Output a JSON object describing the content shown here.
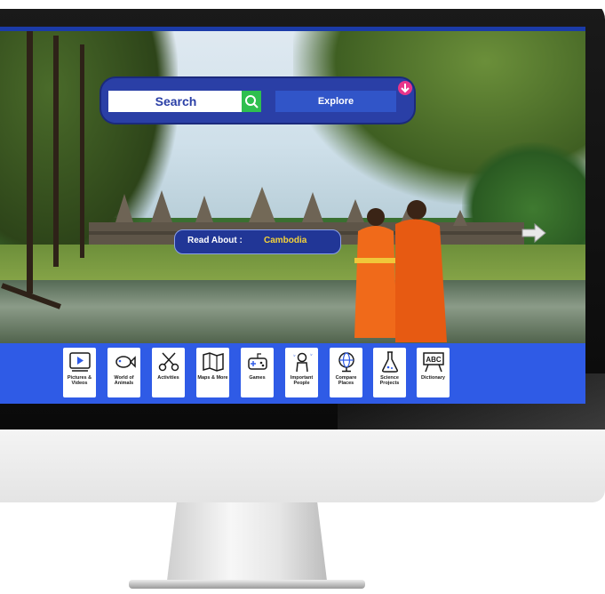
{
  "search": {
    "placeholder": "Search",
    "explore_label": "Explore"
  },
  "read_about": {
    "label": "Read About :",
    "value": "Cambodia"
  },
  "toolbar": {
    "items": [
      {
        "label": "Pictures & Videos",
        "icon": "video-player-icon"
      },
      {
        "label": "World of Animals",
        "icon": "fish-icon"
      },
      {
        "label": "Activities",
        "icon": "scissors-icon"
      },
      {
        "label": "Maps & More",
        "icon": "map-icon"
      },
      {
        "label": "Games",
        "icon": "game-controller-icon"
      },
      {
        "label": "Important People",
        "icon": "astronaut-icon"
      },
      {
        "label": "Compare Places",
        "icon": "globe-icon"
      },
      {
        "label": "Science Projects",
        "icon": "flask-icon"
      },
      {
        "label": "Dictionary",
        "icon": "abc-board-icon"
      }
    ]
  },
  "colors": {
    "toolbar_bg": "#2f5be6",
    "search_frame": "#2a3fa6",
    "search_button": "#2fbf4f",
    "read_about_value": "#f5d33a",
    "download_badge": "#e8358b"
  }
}
